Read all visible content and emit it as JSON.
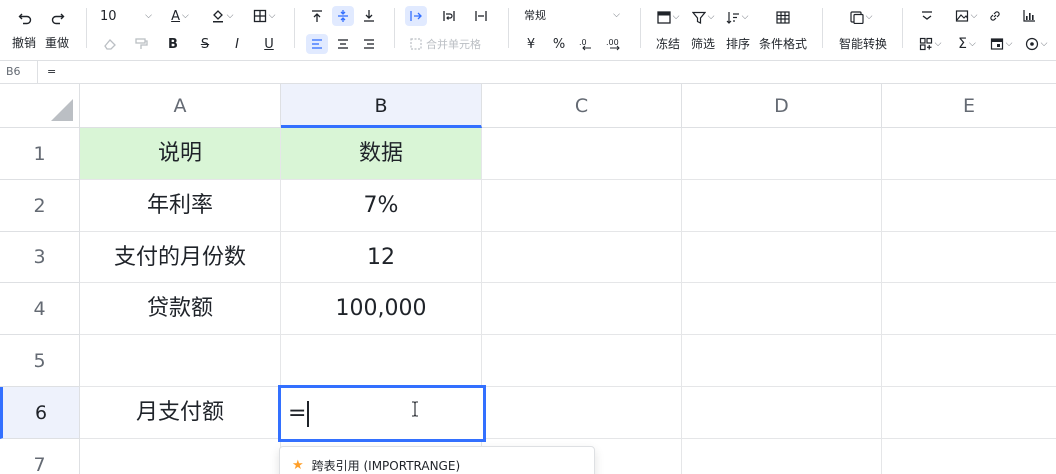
{
  "toolbar": {
    "undo_label": "撤销",
    "redo_label": "重做",
    "font_size": "10",
    "merge_label": "合并单元格",
    "number_format": "常规",
    "currency_symbol": "¥",
    "percent_symbol": "%",
    "freeze_label": "冻结",
    "filter_label": "筛选",
    "sort_label": "排序",
    "conditional_format_label": "条件格式",
    "smart_convert_label": "智能转换",
    "accent_color": "#3370ff"
  },
  "formula_bar": {
    "cell_ref": "B6",
    "formula": "="
  },
  "sheet": {
    "columns": [
      "A",
      "B",
      "C",
      "D",
      "E"
    ],
    "rows": [
      "1",
      "2",
      "3",
      "4",
      "5",
      "6",
      "7"
    ],
    "cells": {
      "A1": "说明",
      "B1": "数据",
      "A2": "年利率",
      "B2": "7%",
      "A3": "支付的月份数",
      "B3": "12",
      "A4": "贷款额",
      "B4": "100,000",
      "A6": "月支付额"
    },
    "active_cell_value": "=",
    "header_fill_color": "#d9f5d6"
  },
  "autocomplete": {
    "item_label": "跨表引用 (IMPORTRANGE)"
  }
}
